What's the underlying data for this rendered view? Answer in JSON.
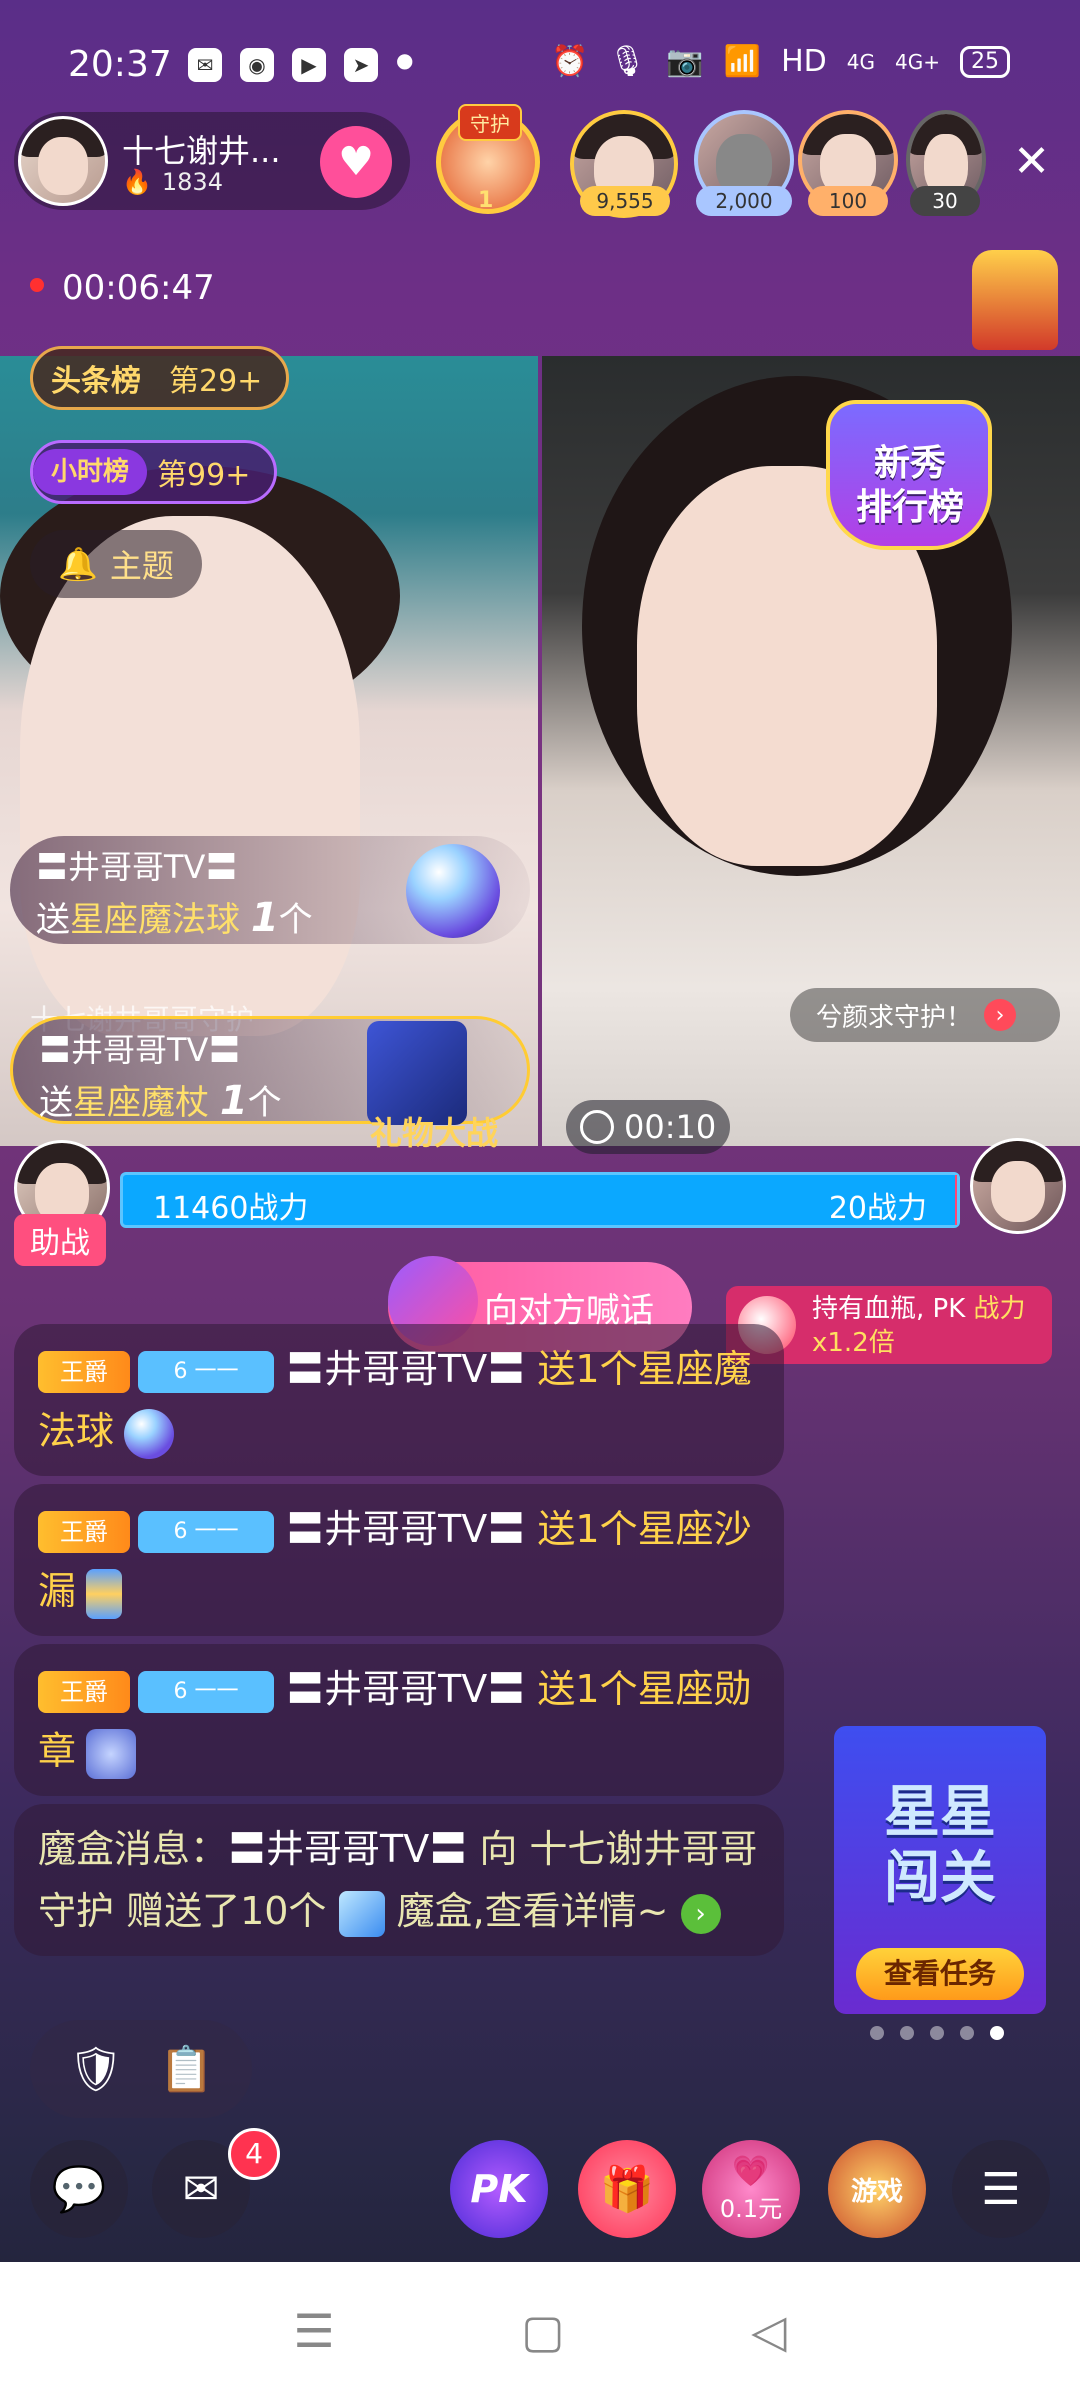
{
  "status_bar": {
    "time": "20:37",
    "network": "HD",
    "signal1": "4G",
    "signal2": "4G+",
    "battery": "25"
  },
  "host": {
    "name": "十七谢井...",
    "fans": "1834"
  },
  "guard": {
    "label": "守护",
    "rank": "1"
  },
  "viewers": [
    {
      "value": "9,555",
      "color": "#ffc94a"
    },
    {
      "value": "2,000",
      "color": "#a9c6ff"
    },
    {
      "value": "100",
      "color": "#ffb06a"
    },
    {
      "value": "30",
      "color": "#444444"
    }
  ],
  "live_timer": "00:06:47",
  "ranks": {
    "headline_tag": "头条榜",
    "headline_rank": "第29+",
    "hour_tag": "小时榜",
    "hour_rank": "第99+"
  },
  "topic_label": "主题",
  "newcomer_label_1": "新秀",
  "newcomer_label_2": "排行榜",
  "gift_toasts": [
    {
      "sender": "〓井哥哥TV〓",
      "prefix": "送",
      "gift": "星座魔法球",
      "count": "1",
      "unit": "个"
    },
    {
      "sender": "〓井哥哥TV〓",
      "prefix": "送",
      "gift": "星座魔杖",
      "count": "1",
      "unit": "个"
    }
  ],
  "guard_caption": "十七谢井哥哥守护",
  "guard_request": "兮颜求守护！",
  "pk": {
    "title": "礼物大战",
    "timer": "00:10",
    "left_power": "11460战力",
    "right_power": "20战力",
    "left_share": 0.998,
    "assist_label": "助战"
  },
  "shout_label": "向对方喊话",
  "potion": {
    "text": "持有血瓶, PK ",
    "highlight": "战",
    "text2": "力x1.2倍"
  },
  "chat": [
    {
      "noble": "王爵",
      "level": "6",
      "level_name": "一一",
      "user": "〓井哥哥TV〓",
      "action": " 送1个星座魔法球"
    },
    {
      "noble": "王爵",
      "level": "6",
      "level_name": "一一",
      "user": "〓井哥哥TV〓",
      "action": " 送1个星座沙漏"
    },
    {
      "noble": "王爵",
      "level": "6",
      "level_name": "一一",
      "user": "〓井哥哥TV〓",
      "action": " 送1个星座勋章"
    }
  ],
  "magic_box": {
    "prefix": "魔盒消息：",
    "user": "〓井哥哥TV〓",
    "mid": " 向 十七谢井哥哥守护 赠送了10个 ",
    "suffix": " 魔盒,查看详情~"
  },
  "star_game": {
    "title_1": "星星",
    "title_2": "闯关",
    "button": "查看任务"
  },
  "bottom": {
    "mail_count": "4",
    "pk_label": "PK",
    "recharge_label": "0.1元",
    "game_label": "游戏"
  }
}
